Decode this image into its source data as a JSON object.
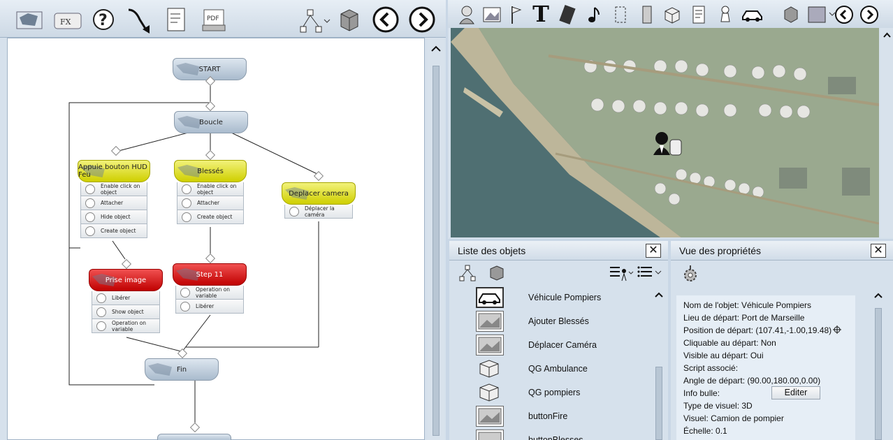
{
  "left_toolbar": {
    "icons": [
      "map-icon",
      "fx-folder-icon",
      "help-icon",
      "arrow-down-icon",
      "script-icon",
      "pdf-icon",
      "tree-icon",
      "box-icon",
      "back-icon",
      "forward-icon"
    ]
  },
  "flow": {
    "start": "START",
    "boucle": "Boucle",
    "node1": {
      "title": "Appuie bouton HUD Feu",
      "rows": [
        "Enable click on object",
        "Attacher",
        "Hide object",
        "Create object"
      ]
    },
    "node2": {
      "title": "Blessés",
      "rows": [
        "Enable click on object",
        "Attacher",
        "Create object"
      ]
    },
    "node3": {
      "title": "Deplacer camera",
      "rows": [
        "Déplacer la caméra"
      ]
    },
    "node4": {
      "title": "Prise image",
      "rows": [
        "Libérer",
        "Show object",
        "Operation on variable"
      ]
    },
    "node5": {
      "title": "Step 11",
      "rows": [
        "Operation on variable",
        "Libérer"
      ]
    },
    "fin": "Fin"
  },
  "map_toolbar": {
    "text_tool": "T"
  },
  "object_list": {
    "title": "Liste des objets",
    "close": "✕",
    "items": [
      "Véhicule Pompiers",
      "Ajouter Blessés",
      "Déplacer Caméra",
      "QG Ambulance",
      "QG pompiers",
      "buttonFire",
      "buttonBlesses"
    ]
  },
  "properties": {
    "title": "Vue des propriétés",
    "close": "✕",
    "rows": [
      "Nom de l'objet: Véhicule Pompiers",
      "Lieu de départ: Port de Marseille",
      "Position de départ: (107.41,-1.00,19.48)",
      "Cliquable au départ: Non",
      "Visible au départ: Oui",
      "Script associé:",
      "Angle de départ: (90.00,180.00,0.00)",
      "Info bulle:",
      "Type de visuel: 3D",
      "Visuel: Camion de pompier",
      "Échelle: 0.1"
    ],
    "edit_button": "Editer"
  }
}
